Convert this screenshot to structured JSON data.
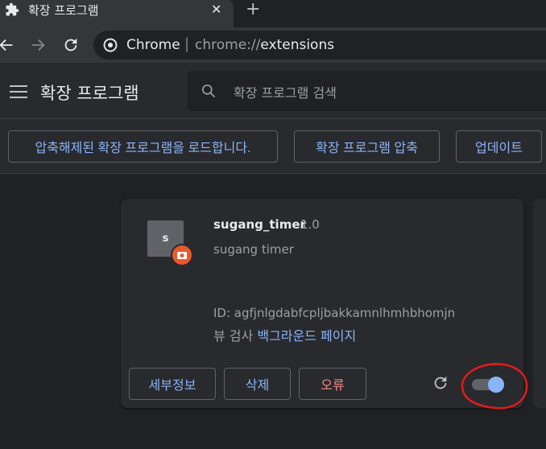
{
  "tab": {
    "title": "확장 프로그램",
    "close_glyph": "✕",
    "new_tab_glyph": "+"
  },
  "omnibox": {
    "scheme_label": "Chrome",
    "separator": "|",
    "url_prefix": "chrome://",
    "url_path": "extensions"
  },
  "header": {
    "title": "확장 프로그램",
    "search_placeholder": "확장 프로그램 검색"
  },
  "actions": {
    "load_unpacked": "압축해제된 확장 프로그램을 로드합니다.",
    "pack": "확장 프로그램 압축",
    "update": "업데이트"
  },
  "extension": {
    "icon_letter": "s",
    "name": "sugang_timer",
    "version": "1.0",
    "description": "sugang timer",
    "id_text": "ID: agfjnlgdabfcpljbakkamnlhmhbhomjn",
    "inspect_label": "뷰 검사",
    "inspect_link": "백그라운드 페이지",
    "details_button": "세부정보",
    "remove_button": "삭제",
    "errors_button": "오류",
    "enabled": true
  },
  "colors": {
    "accent": "#8ab4f8",
    "error": "#f28b82",
    "badge": "#e8592b",
    "annotation": "#e31b1b"
  }
}
